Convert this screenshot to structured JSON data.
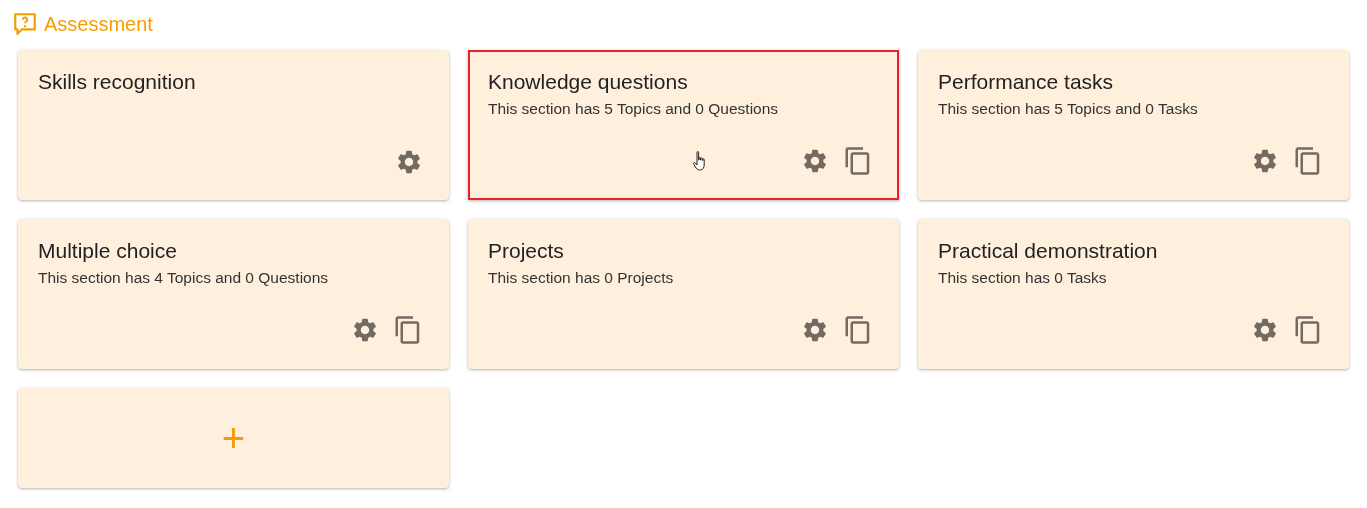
{
  "header": {
    "title": "Assessment"
  },
  "cards": [
    {
      "kind": "section",
      "title": "Skills recognition",
      "selected": false,
      "hovered": false,
      "copyable": false
    },
    {
      "kind": "section",
      "title": "Knowledge questions",
      "subtitle": "This section has 5 Topics and 0 Questions",
      "selected": true,
      "hovered": true,
      "copyable": true
    },
    {
      "kind": "section",
      "title": "Performance tasks",
      "subtitle": "This section has 5 Topics and 0 Tasks",
      "selected": false,
      "hovered": false,
      "copyable": true
    },
    {
      "kind": "section",
      "title": "Multiple choice",
      "subtitle": "This section has 4 Topics and 0 Questions",
      "selected": false,
      "hovered": false,
      "copyable": true
    },
    {
      "kind": "section",
      "title": "Projects",
      "subtitle": "This section has 0 Projects",
      "selected": false,
      "hovered": false,
      "copyable": true
    },
    {
      "kind": "section",
      "title": "Practical demonstration",
      "subtitle": "This section has 0 Tasks",
      "selected": false,
      "hovered": false,
      "copyable": true
    },
    {
      "kind": "add",
      "label": "+",
      "selected": false
    }
  ]
}
